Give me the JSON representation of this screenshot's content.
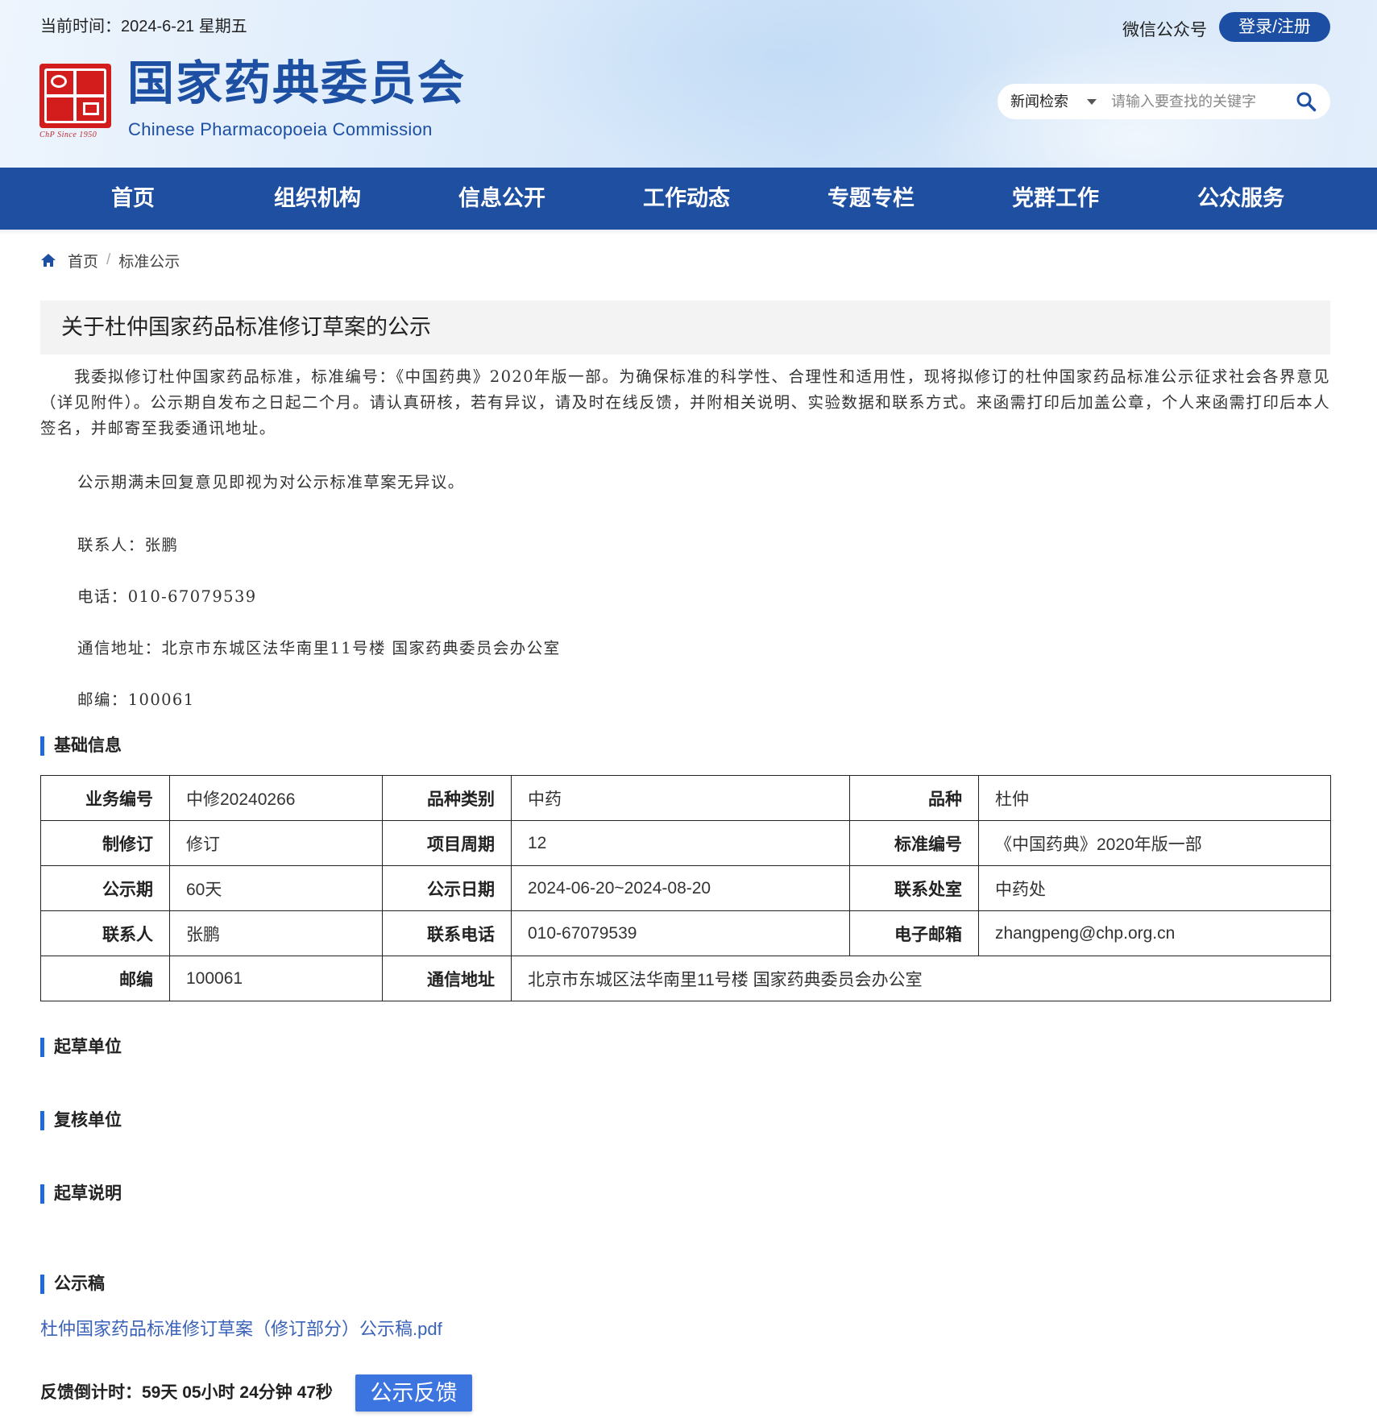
{
  "header": {
    "current_time": "当前时间：2024-6-21 星期五",
    "wechat": "微信公众号",
    "login_label": "登录/注册",
    "logo_cn": "国家药典委员会",
    "logo_en": "Chinese Pharmacopoeia Commission",
    "logo_since": "ChP Since 1950",
    "search": {
      "category": "新闻检索",
      "placeholder": "请输入要查找的关键字"
    }
  },
  "nav": {
    "items": [
      "首页",
      "组织机构",
      "信息公开",
      "工作动态",
      "专题专栏",
      "党群工作",
      "公众服务"
    ]
  },
  "breadcrumb": {
    "home": "首页",
    "separator": "/",
    "current": "标准公示"
  },
  "article": {
    "title": "关于杜仲国家药品标准修订草案的公示",
    "paragraph": "我委拟修订杜仲国家药品标准，标准编号：《中国药典》2020年版一部。为确保标准的科学性、合理性和适用性，现将拟修订的杜仲国家药品标准公示征求社会各界意见（详见附件）。公示期自发布之日起二个月。请认真研核，若有异议，请及时在线反馈，并附相关说明、实验数据和联系方式。来函需打印后加盖公章，个人来函需打印后本人签名，并邮寄至我委通讯地址。",
    "notice": "公示期满未回复意见即视为对公示标准草案无异议。",
    "contact": "联系人：张鹏",
    "phone": "电话：010-67079539",
    "address": "通信地址：北京市东城区法华南里11号楼 国家药典委员会办公室",
    "postcode": "邮编：100061"
  },
  "sections": {
    "basic_info": "基础信息",
    "drafting_unit": "起草单位",
    "review_unit": "复核单位",
    "drafting_note": "起草说明",
    "draft": "公示稿"
  },
  "info_table": {
    "rows": [
      [
        "业务编号",
        "中修20240266",
        "品种类别",
        "中药",
        "品种",
        "杜仲"
      ],
      [
        "制修订",
        "修订",
        "项目周期",
        "12",
        "标准编号",
        "《中国药典》2020年版一部"
      ],
      [
        "公示期",
        "60天",
        "公示日期",
        "2024-06-20~2024-08-20",
        "联系处室",
        "中药处"
      ],
      [
        "联系人",
        "张鹏",
        "联系电话",
        "010-67079539",
        "电子邮箱",
        "zhangpeng@chp.org.cn"
      ]
    ],
    "last_row": [
      "邮编",
      "100061",
      "通信地址",
      "北京市东城区法华南里11号楼 国家药典委员会办公室"
    ]
  },
  "attachment": {
    "filename": "杜仲国家药品标准修订草案（修订部分）公示稿.pdf"
  },
  "feedback": {
    "countdown": "反馈倒计时：59天 05小时 24分钟 47秒",
    "button": "公示反馈"
  },
  "colors": {
    "brand_blue": "#1e4fa0",
    "seal_red": "#d31d1d",
    "accent": "#1e6ad6",
    "link": "#3a62b8"
  }
}
